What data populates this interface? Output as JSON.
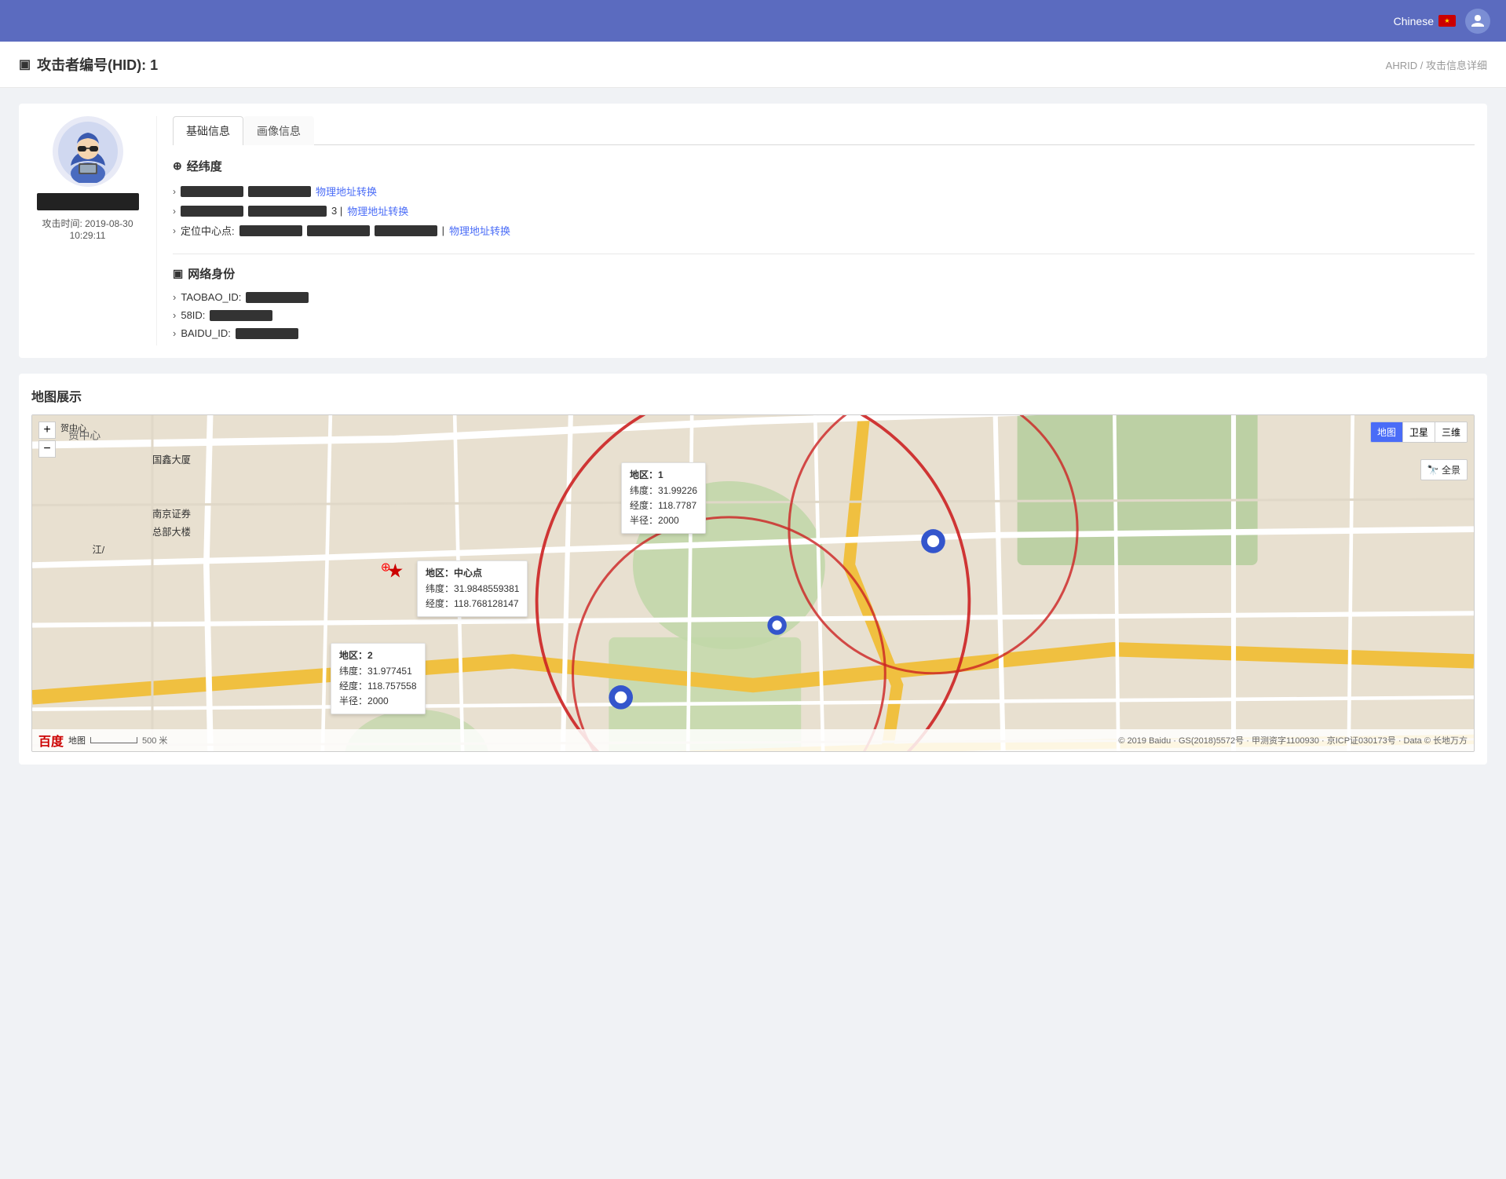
{
  "header": {
    "lang_label": "Chinese",
    "avatar_label": "👤"
  },
  "page": {
    "title_icon": "▣",
    "title": "攻击者编号(HID): 1",
    "breadcrumb_root": "AHRID",
    "breadcrumb_sep": "/",
    "breadcrumb_current": "攻击信息详细"
  },
  "profile": {
    "attack_time_label": "攻击时间: 2019-08-30",
    "attack_time_sub": "10:29:11"
  },
  "tabs": [
    {
      "id": "basic",
      "label": "基础信息",
      "active": true
    },
    {
      "id": "portrait",
      "label": "画像信息",
      "active": false
    }
  ],
  "location_section": {
    "icon": "⊕",
    "title": "经纬度",
    "items": [
      {
        "arrow": ">",
        "link_text": "物理地址转换"
      },
      {
        "arrow": ">",
        "suffix": "3 |",
        "link_text": "物理地址转换"
      },
      {
        "arrow": ">",
        "prefix": "定位中心点:",
        "suffix": "|",
        "link_text": "物理地址转换"
      }
    ]
  },
  "network_section": {
    "icon": "▣",
    "title": "网络身份",
    "items": [
      {
        "arrow": ">",
        "label": "TAOBAO_ID:"
      },
      {
        "arrow": ">",
        "label": "58ID:"
      },
      {
        "arrow": ">",
        "label": "BAIDU_ID:"
      }
    ]
  },
  "map_section": {
    "title": "地图展示",
    "controls": {
      "map_btn": "地图",
      "satellite_btn": "卫星",
      "three_d_btn": "三维",
      "panorama_btn": "全景"
    },
    "popup1": {
      "title": "地区：中心点",
      "lat_label": "纬度：",
      "lat_value": "31.9848559381",
      "lng_label": "经度：",
      "lng_value": "118.768128147"
    },
    "popup2": {
      "title": "地区：1",
      "lat_label": "纬度：",
      "lat_value": "31.99226",
      "lng_label": "经度：",
      "lng_value": "118.7787",
      "radius_label": "半径：",
      "radius_value": "2000"
    },
    "popup3": {
      "title": "地区：2",
      "lat_label": "纬度：",
      "lat_value": "31.977451",
      "lng_label": "经度：",
      "lng_value": "118.757558",
      "radius_label": "半径：",
      "radius_value": "2000"
    },
    "footer_copyright": "© 2019 Baidu · GS(2018)5572号 · 甲测资字1100930 · 京ICP证030173号 · Data © 长地万方",
    "scale_label": "500 米",
    "nav_label": "贺中心"
  }
}
